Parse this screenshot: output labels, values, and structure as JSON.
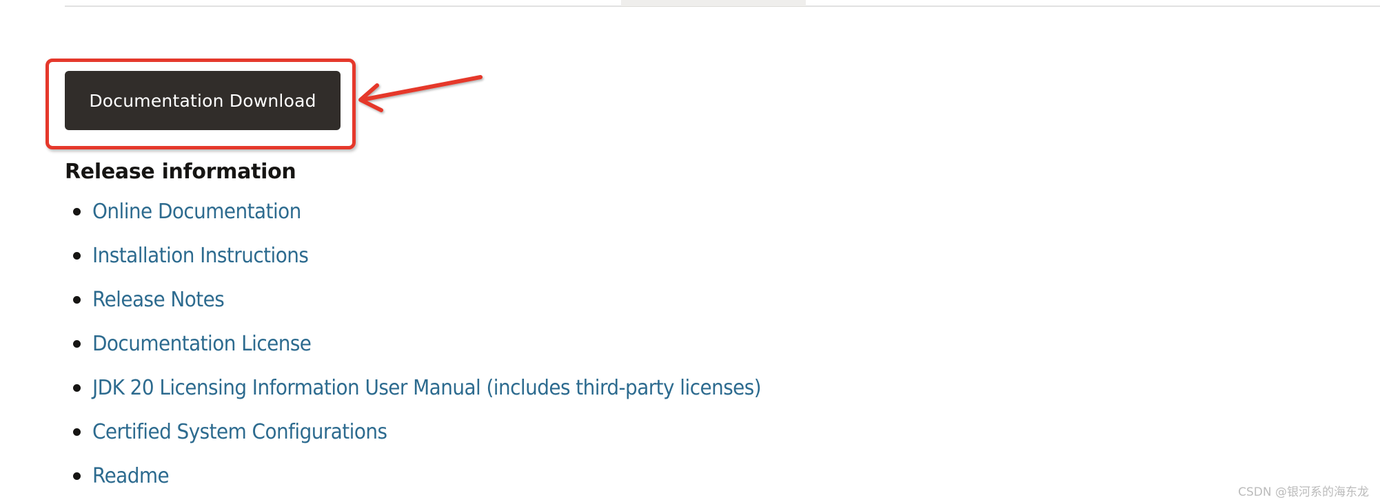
{
  "top_nav": {
    "active_tab_label": ""
  },
  "download_button": {
    "label": "Documentation Download"
  },
  "annotation": {
    "highlight_color": "#e5382b",
    "target": "download_button"
  },
  "release_section": {
    "heading": "Release information",
    "links": [
      {
        "label": "Online Documentation"
      },
      {
        "label": "Installation Instructions"
      },
      {
        "label": "Release Notes"
      },
      {
        "label": "Documentation License"
      },
      {
        "label": "JDK 20 Licensing Information User Manual (includes third-party licenses)"
      },
      {
        "label": "Certified System Configurations"
      },
      {
        "label": "Readme"
      }
    ]
  },
  "watermark": {
    "text": "CSDN @银河系的海东龙"
  },
  "colors": {
    "button_bg": "#312d2a",
    "button_text": "#ffffff",
    "link": "#2d6b8f",
    "heading": "#161513",
    "annotation_red": "#e5382b"
  }
}
